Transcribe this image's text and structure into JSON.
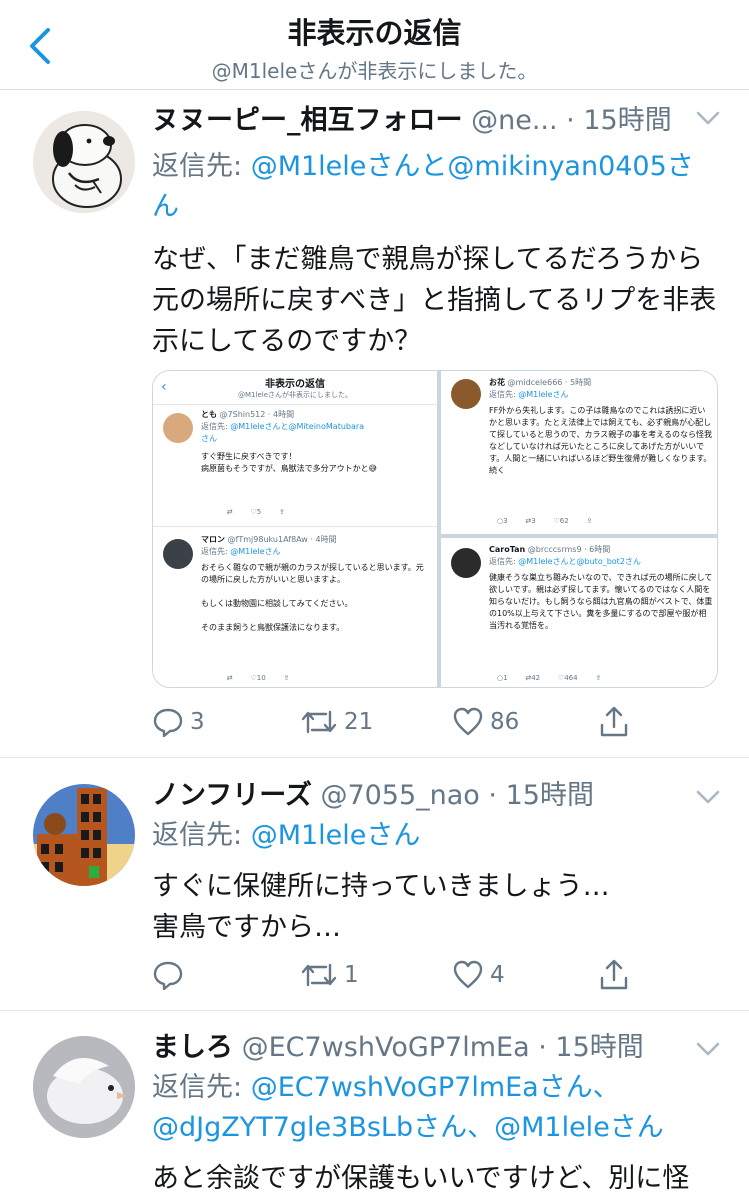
{
  "header": {
    "title": "非表示の返信",
    "subtitle": "@M1leleさんが非表示にしました。"
  },
  "tweets": [
    {
      "name": "ヌヌーピー_相互フォロー",
      "handle": "@ne...",
      "time": "· 15時間",
      "reply_prefix": "返信先: ",
      "reply_to": "@M1leleさんと@mikinyan0405さん",
      "text": "なぜ、「まだ雛鳥で親鳥が探してるだろうから元の場所に戻すべき」と指摘してるリプを非表示にしてるのですか？",
      "replies": "3",
      "retweets": "21",
      "likes": "86"
    },
    {
      "name": "ノンフリーズ",
      "handle": "@7055_nao",
      "time": "· 15時間",
      "reply_prefix": "返信先: ",
      "reply_to": "@M1leleさん",
      "text": "すぐに保健所に持っていきましょう…\n害鳥ですから…",
      "replies": "",
      "retweets": "1",
      "likes": "4"
    },
    {
      "name": "ましろ",
      "handle": "@EC7wshVoGP7lmEa",
      "time": "· 15時間",
      "reply_prefix": "返信先: ",
      "reply_to": "@EC7wshVoGP7lmEaさん、@dJgZYT7gle3BsLbさん、@M1leleさん",
      "text": "あと余談ですが保護もいいですけど、別に怪"
    }
  ],
  "embedded_screenshot": {
    "header_title": "非表示の返信",
    "header_sub": "@M1leleさんが非表示にしました。",
    "left": [
      {
        "name": "とも",
        "handle": "@7Shin512 · 4時間",
        "reply_prefix": "返信先: ",
        "reply_to": "@M1leleさんと@MiteinoMatubara",
        "reply_cont": "さん",
        "text": "すぐ野生に戻すべきです！\n病原菌もそうですが、鳥獣法で多分アウトかと😅",
        "actions": "        ⇄        ♡5        ⇪"
      },
      {
        "name": "マロン",
        "handle": "@fTmj98uku1Af8Aw · 4時間",
        "reply_prefix": "返信先: ",
        "reply_to": "@M1leleさん",
        "text": "おそらく雛なので親が親のカラスが探していると思います。元の場所に戻した方がいいと思いますよ。\n\nもしくは動物園に相談してみてください。\n\nそのまま飼うと鳥獣保護法になります。",
        "actions": "        ⇄        ♡10        ⇪"
      }
    ],
    "right": [
      {
        "name": "お花",
        "handle": "@midcele666 · 5時間",
        "reply_prefix": "返信先: ",
        "reply_to": "@M1leleさん",
        "text": "FF外から失礼します。この子は雛鳥なのでこれは誘拐に近いかと思います。たとえ法律上では飼えても、必ず親鳥が心配して探していると思うので、カラス親子の事を考えるのなら怪我などしていなければ元いたところに戻してあげた方がいいです。人間と一緒にいればいるほど野生復帰が難しくなります。続く",
        "actions": "○3        ⇄3        ♡62        ⇪"
      },
      {
        "name": "CaroTan",
        "handle": "@brcccsrms9 · 6時間",
        "reply_prefix": "返信先: ",
        "reply_to": "@M1leleさんと@buto_bot2さん",
        "text": "健康そうな巣立ち雛みたいなので、できれば元の場所に戻して欲しいです。親は必ず探してます。懐いてるのではなく人間を知らないだけ。もし飼うなら餌は九官鳥の餌がベストで、体重の10%以上与えて下さい。糞を多量にするので部屋や服が相当汚れる覚悟を。",
        "actions": "○1        ⇄42        ♡464        ⇪"
      }
    ]
  },
  "icons": [
    "back-icon",
    "chevron-down-icon",
    "reply-icon",
    "retweet-icon",
    "like-icon",
    "share-icon"
  ],
  "colors": {
    "link": "#1b95e0",
    "muted": "#657786",
    "text": "#14171a",
    "divider": "#e1e8ed"
  }
}
